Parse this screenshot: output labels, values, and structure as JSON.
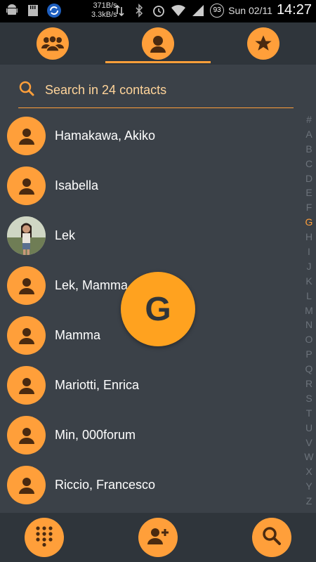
{
  "status_bar": {
    "net_up": "371B/s",
    "net_down": "3.3kB/s",
    "battery": "93",
    "date": "Sun 02/11",
    "time": "14:27",
    "icons": [
      "android-icon",
      "sd-card-icon",
      "sync-icon",
      "data-arrows-icon",
      "bluetooth-icon",
      "alarm-icon",
      "wifi-icon",
      "signal-icon",
      "battery-icon"
    ]
  },
  "tabs": [
    {
      "name": "groups",
      "icon": "group-icon"
    },
    {
      "name": "contacts",
      "icon": "person-icon",
      "selected": true
    },
    {
      "name": "favorites",
      "icon": "star-icon"
    }
  ],
  "search": {
    "placeholder": "Search in 24 contacts"
  },
  "contacts": [
    {
      "name": "Hamakawa, Akiko",
      "photo": false
    },
    {
      "name": "Isabella",
      "photo": false
    },
    {
      "name": "Lek",
      "photo": true
    },
    {
      "name": "Lek, Mamma",
      "photo": false
    },
    {
      "name": "Mamma",
      "photo": false
    },
    {
      "name": "Mariotti, Enrica",
      "photo": false
    },
    {
      "name": "Min, 000forum",
      "photo": false
    },
    {
      "name": "Riccio, Francesco",
      "photo": false
    }
  ],
  "alphabet": [
    "#",
    "A",
    "B",
    "C",
    "D",
    "E",
    "F",
    "G",
    "H",
    "I",
    "J",
    "K",
    "L",
    "M",
    "N",
    "O",
    "P",
    "Q",
    "R",
    "S",
    "T",
    "U",
    "V",
    "W",
    "X",
    "Y",
    "Z"
  ],
  "active_letter": "G",
  "bubble_letter": "G",
  "bottom_actions": [
    {
      "name": "dialpad",
      "icon": "dialpad-icon"
    },
    {
      "name": "add-contact",
      "icon": "add-person-icon"
    },
    {
      "name": "search",
      "icon": "search-icon"
    }
  ],
  "colors": {
    "accent": "#ff9f3a",
    "background": "#3b4148",
    "bar": "#2f353b",
    "icon_dark": "#4a2a10"
  }
}
